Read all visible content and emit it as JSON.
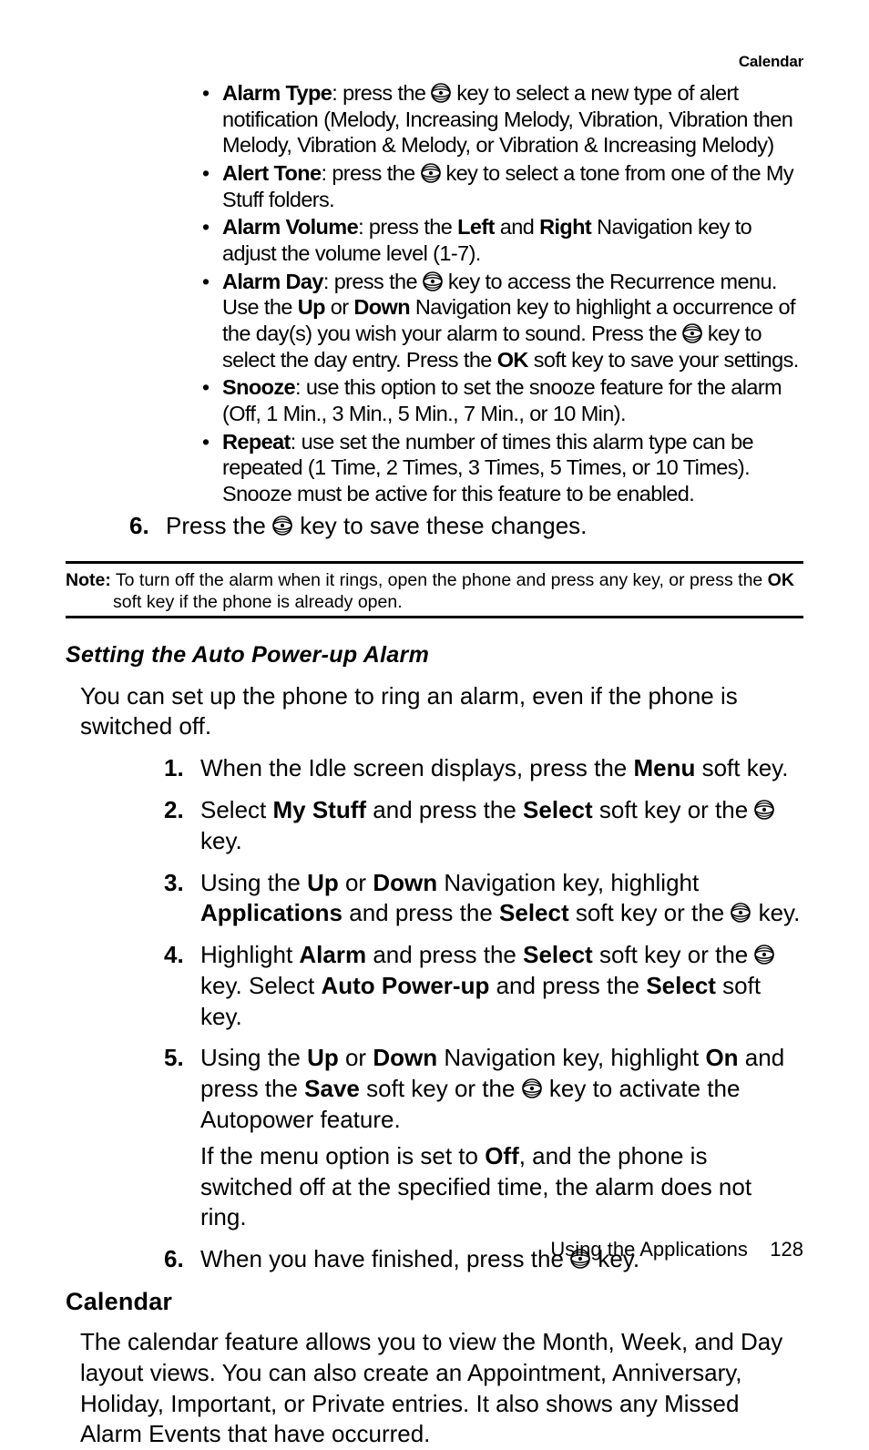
{
  "running_head": "Calendar",
  "iconAlt": "OK key",
  "top_bullets": [
    {
      "label": "Alarm Type",
      "t1": ": press the ",
      "t2": " key to select a new type of alert notification (Melody, Increasing Melody, Vibration, Vibration then Melody, Vibration & Melody, or Vibration & Increasing Melody)"
    },
    {
      "label": "Alert Tone",
      "t1": ": press the ",
      "t2": " key to select a tone from one of the My Stuff folders."
    },
    {
      "label": "Alarm Volume",
      "plain": ": press the ",
      "b1": "Left",
      "mid": " and ",
      "b2": "Right",
      "tail": " Navigation key to adjust the volume level (1-7)."
    },
    {
      "label": "Alarm Day",
      "t1": ": press the ",
      "t2": " key to access the Recurrence menu. Use the ",
      "b1": "Up",
      "mid": " or ",
      "b2": "Down",
      "t3": " Navigation key to highlight a occurrence of the day(s) you wish your alarm to sound. Press the ",
      "t4": " key to select the day entry. Press the ",
      "b3": "OK",
      "t5": " soft key to save your settings."
    },
    {
      "label": "Snooze",
      "plain_full": ": use this option to set the snooze feature for the alarm (Off, 1 Min., 3 Min., 5 Min., 7 Min., or 10 Min)."
    },
    {
      "label": "Repeat",
      "plain_full": ": use set the number of times this alarm type can be repeated (1 Time, 2 Times, 3 Times, 5 Times, or 10 Times). Snooze must be active for this feature to be enabled."
    }
  ],
  "top_step6": {
    "num": "6.",
    "pre": "Press the ",
    "post": " key to save these changes."
  },
  "note": {
    "label": "Note:",
    "text_a": " To turn off the alarm when it rings, open the phone and press any key, or press the ",
    "b": "OK",
    "text_b": " soft key if the phone is already open."
  },
  "section1_title": "Setting the Auto Power-up Alarm",
  "section1_lead": "You can set up the phone to ring an alarm, even if the phone is switched off.",
  "steps": [
    {
      "t0": "When the Idle screen displays, press the ",
      "b0": "Menu",
      "t1": " soft key."
    },
    {
      "t0": "Select ",
      "b0": "My Stuff",
      "t1": " and press the ",
      "b1": "Select",
      "t2": " soft key or the ",
      "t3": " key."
    },
    {
      "t0": "Using the ",
      "b0": "Up",
      "t1": " or ",
      "b1": "Down",
      "t2": " Navigation key, highlight ",
      "b2": "Applications",
      "t3": " and press the ",
      "b3": "Select",
      "t4": " soft key or the ",
      "t5": " key."
    },
    {
      "t0": "Highlight ",
      "b0": "Alarm",
      "t1": " and press the ",
      "b1": "Select",
      "t2": " soft key or the ",
      "t3": " key. Select ",
      "b2": "Auto Power-up",
      "t4": " and press the ",
      "b3": "Select",
      "t5": " soft key."
    },
    {
      "t0": "Using the ",
      "b0": "Up",
      "t1": " or ",
      "b1": "Down",
      "t2": " Navigation key, highlight ",
      "b2": "On",
      "t3": " and press the ",
      "b3": "Save",
      "t4": " soft key or the ",
      "t5": " key to activate the Autopower feature.",
      "sub_a": "If the menu option is set to ",
      "sub_b": "Off",
      "sub_c": ", and the phone is switched off at the specified time, the alarm does not ring."
    },
    {
      "t0": "When you have finished, press the ",
      "t1": " key."
    }
  ],
  "section2_title": "Calendar",
  "section2_body": "The calendar feature allows you to view the Month, Week, and Day layout views. You can also create an Appointment, Anniversary, Holiday, Important, or Private entries. It also shows any Missed Alarm Events that have occurred.",
  "footer": {
    "title": "Using the Applications",
    "page": "128"
  }
}
